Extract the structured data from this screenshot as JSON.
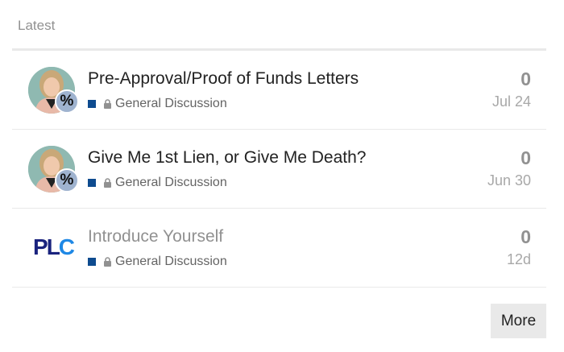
{
  "header": {
    "title": "Latest"
  },
  "topics": [
    {
      "title": "Pre-Approval/Proof of Funds Letters",
      "category": "General Discussion",
      "replies": "0",
      "activity": "Jul 24",
      "avatar_icon": "user-photo-avatar",
      "avatar_badge": "%",
      "read": false
    },
    {
      "title": "Give Me 1st Lien, or Give Me Death?",
      "category": "General Discussion",
      "replies": "0",
      "activity": "Jun 30",
      "avatar_icon": "user-photo-avatar",
      "avatar_badge": "%",
      "read": false
    },
    {
      "title": "Introduce Yourself",
      "category": "General Discussion",
      "replies": "0",
      "activity": "12d",
      "avatar_icon": "plc-logo-avatar",
      "avatar_logo": {
        "p": "P",
        "l": "L",
        "c": "C"
      },
      "read": true
    }
  ],
  "footer": {
    "more_label": "More"
  },
  "colors": {
    "category": "#0e4b8f",
    "badge": "#9fb3cf",
    "muted": "#919191",
    "divider": "#e9e9e9"
  }
}
